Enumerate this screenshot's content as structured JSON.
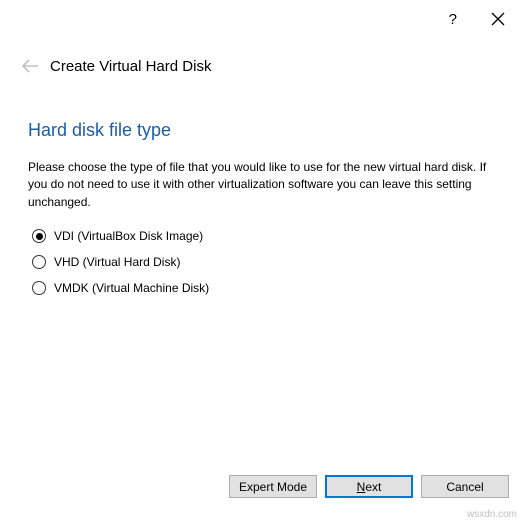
{
  "titlebar": {
    "help": "?",
    "close": "✕"
  },
  "header": {
    "wizard_title": "Create Virtual Hard Disk"
  },
  "page": {
    "heading": "Hard disk file type",
    "description": "Please choose the type of file that you would like to use for the new virtual hard disk. If you do not need to use it with other virtualization software you can leave this setting unchanged."
  },
  "options": [
    {
      "label": "VDI (VirtualBox Disk Image)",
      "selected": true
    },
    {
      "label": "VHD (Virtual Hard Disk)",
      "selected": false
    },
    {
      "label": "VMDK (Virtual Machine Disk)",
      "selected": false
    }
  ],
  "buttons": {
    "expert": "Expert Mode",
    "next_prefix": "N",
    "next_rest": "ext",
    "cancel": "Cancel"
  },
  "watermark": "wsxdn.com"
}
